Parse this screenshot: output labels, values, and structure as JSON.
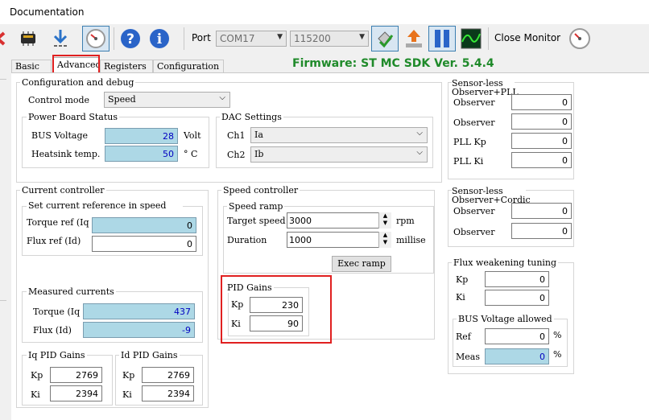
{
  "menubar": {
    "title": "Documentation"
  },
  "toolbar": {
    "port_label": "Port",
    "port_value": "COM17",
    "baud_value": "115200",
    "close_monitor_label": "Close Monitor"
  },
  "tabs": [
    "Basic",
    "Advanced",
    "Registers",
    "Configuration"
  ],
  "firmware": "Firmware: ST MC SDK Ver. 5.4.4",
  "config_debug": {
    "title": "Configuration and debug",
    "control_mode_label": "Control mode",
    "control_mode_value": "Speed"
  },
  "power_board": {
    "title": "Power Board Status",
    "bus_voltage_label": "BUS Voltage",
    "bus_voltage_value": "28",
    "bus_voltage_unit": "Volt",
    "heatsink_label": "Heatsink temp.",
    "heatsink_value": "50",
    "heatsink_unit": "° C"
  },
  "dac": {
    "title": "DAC Settings",
    "ch1_label": "Ch1",
    "ch1_value": "Ia",
    "ch2_label": "Ch2",
    "ch2_value": "Ib"
  },
  "observer_pll": {
    "title": "Sensor-less Observer+PLL",
    "rows": [
      {
        "label": "Observer",
        "value": "0"
      },
      {
        "label": "Observer",
        "value": "0"
      },
      {
        "label": "PLL Kp",
        "value": "0"
      },
      {
        "label": "PLL Ki",
        "value": "0"
      }
    ]
  },
  "observer_cordic": {
    "title": "Sensor-less Observer+Cordic",
    "rows": [
      {
        "label": "Observer",
        "value": "0"
      },
      {
        "label": "Observer",
        "value": "0"
      }
    ]
  },
  "current_controller": {
    "title": "Current controller",
    "set_ref_title": "Set current reference in speed mode",
    "torque_ref_label": "Torque ref (Iq",
    "torque_ref_value": "0",
    "flux_ref_label": "Flux ref (Id)",
    "flux_ref_value": "0",
    "measured_title": "Measured currents",
    "torque_label": "Torque (Iq",
    "torque_value": "437",
    "flux_label": "Flux (Id)",
    "flux_value": "-9",
    "iq_pid_title": "Iq PID Gains",
    "iq_kp_label": "Kp",
    "iq_kp": "2769",
    "iq_ki_label": "Ki",
    "iq_ki": "2394",
    "id_pid_title": "Id PID Gains",
    "id_kp_label": "Kp",
    "id_kp": "2769",
    "id_ki_label": "Ki",
    "id_ki": "2394"
  },
  "speed_controller": {
    "title": "Speed controller",
    "ramp_title": "Speed ramp",
    "target_label": "Target speed",
    "target_value": "3000",
    "target_unit": "rpm",
    "duration_label": "Duration",
    "duration_value": "1000",
    "duration_unit": "millise",
    "exec_ramp_label": "Exec ramp",
    "pid_title": "PID Gains",
    "kp_label": "Kp",
    "kp_value": "230",
    "ki_label": "Ki",
    "ki_value": "90"
  },
  "flux_weakening": {
    "title": "Flux weakening tuning",
    "kp_label": "Kp",
    "kp_value": "0",
    "ki_label": "Ki",
    "ki_value": "0",
    "bus_title": "BUS Voltage allowed",
    "ref_label": "Ref",
    "ref_value": "0",
    "ref_unit": "%",
    "meas_label": "Meas",
    "meas_value": "0",
    "meas_unit": "%"
  },
  "colors": {
    "readonly_bg": "#add8e6",
    "readonly_text": "#0000c0",
    "firmware": "#1f8a2a",
    "highlight": "#e02020"
  }
}
